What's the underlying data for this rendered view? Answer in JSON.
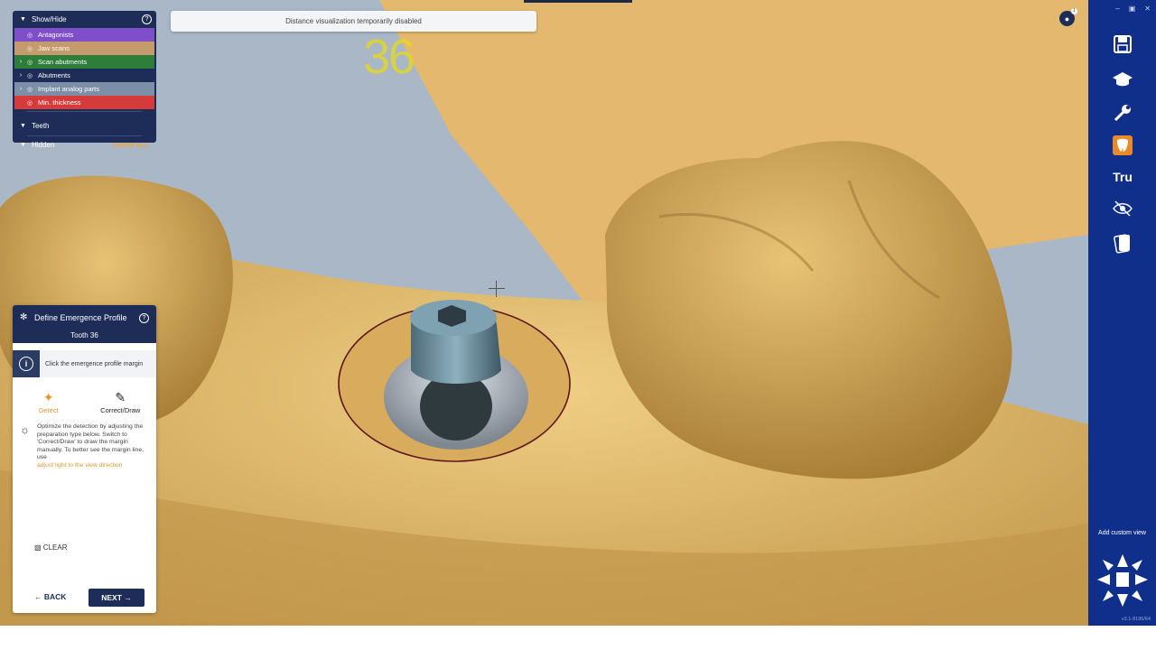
{
  "notice": {
    "text": "Distance visualization temporarily disabled"
  },
  "viewport": {
    "tooth_number": "36"
  },
  "show_hide": {
    "title": "Show/Hide",
    "layers": [
      {
        "label": "Antagonists",
        "color": "#7f4fc9",
        "expandable": false
      },
      {
        "label": "Jaw scans",
        "color": "#c59a6c",
        "expandable": false
      },
      {
        "label": "Scan abutments",
        "color": "#2e7d3a",
        "expandable": true
      },
      {
        "label": "Abutments",
        "color": "#1d2d57",
        "expandable": true
      },
      {
        "label": "Implant analog parts",
        "color": "#7d8fa8",
        "expandable": true
      },
      {
        "label": "Min. thickness",
        "color": "#d63b3b",
        "expandable": false
      }
    ],
    "teeth_label": "Teeth",
    "hidden_label": "Hidden",
    "show_all_label": "SHOW ALL"
  },
  "define_panel": {
    "title": "Define Emergence Profile",
    "subtitle": "Tooth 36",
    "instruction": "Click the emergence profile margin",
    "modes": [
      {
        "label": "Detect",
        "active": true
      },
      {
        "label": "Correct/Draw",
        "active": false
      }
    ],
    "tip_text": "Optimize the detection by adjusting the preparation type below. Switch to 'Correct/Draw' to draw the margin manually. To better see the margin line, use",
    "tip_link": "adjust light to the view direction",
    "clear_label": "CLEAR",
    "back_label": "BACK",
    "next_label": "NEXT"
  },
  "toolbar": {
    "tools": [
      "save-icon",
      "graduation-cap-icon",
      "wrench-icon",
      "tooth-tool-icon",
      "tru-icon",
      "visibility-icon",
      "cards-icon"
    ],
    "tru_label": "Tru",
    "custom_view_label": "Add custom view",
    "version": "v3.1-8186/64",
    "notification_count": "1"
  }
}
